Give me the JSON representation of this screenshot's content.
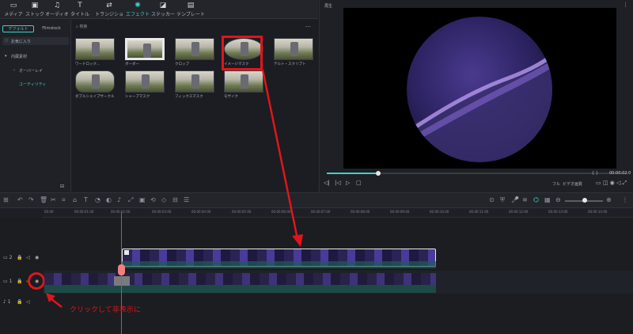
{
  "top_tabs": [
    {
      "label": "メディア",
      "icon": "folder-icon"
    },
    {
      "label": "ストック",
      "icon": "stock-icon"
    },
    {
      "label": "オーディオ",
      "icon": "music-icon"
    },
    {
      "label": "タイトル",
      "icon": "title-icon"
    },
    {
      "label": "トランジション",
      "icon": "transition-icon"
    },
    {
      "label": "エフェクト",
      "icon": "effects-icon"
    },
    {
      "label": "ステッカー",
      "icon": "sticker-icon"
    },
    {
      "label": "テンプレート",
      "icon": "template-icon"
    }
  ],
  "sidebar": {
    "tabs": [
      "デフォルト",
      "Filmstock"
    ],
    "favorites": "お気に入り",
    "category": "内蔵素材",
    "sub1": "オーバーレイ",
    "sub2": "ユーティリティ"
  },
  "effects": {
    "search_placeholder": "検索",
    "more": "…",
    "items": [
      "ワードロック...",
      "ボーダー",
      "クロップ",
      "イメージマスク",
      "テルト・スクリプト",
      "ダブルシェイプサークル",
      "シャープマスク",
      "フィックスマスク",
      "モザイク"
    ]
  },
  "preview": {
    "title": "再生",
    "time": "00:00:02:0",
    "quality": "フル",
    "view": "ビデオ画質"
  },
  "timeline": {
    "ticks": [
      "00:00",
      "00:00:01:00",
      "00:00:02:00",
      "00:00:03:00",
      "00:00:04:00",
      "00:00:05:00",
      "00:00:06:00",
      "00:00:07:00",
      "00:00:08:00",
      "00:00:09:00",
      "00:00:10:00",
      "00:00:11:00",
      "00:00:12:00",
      "00:00:13:00",
      "00:00:14:00"
    ],
    "track2": "2",
    "track1": "1",
    "audio": "1",
    "playhead_label": "00:00:03:00"
  },
  "annotation": {
    "text": "クリックして非表示に",
    "highlight_color": "#e0151b"
  },
  "colors": {
    "accent": "#3fd2c7",
    "annotation": "#e0151b"
  }
}
